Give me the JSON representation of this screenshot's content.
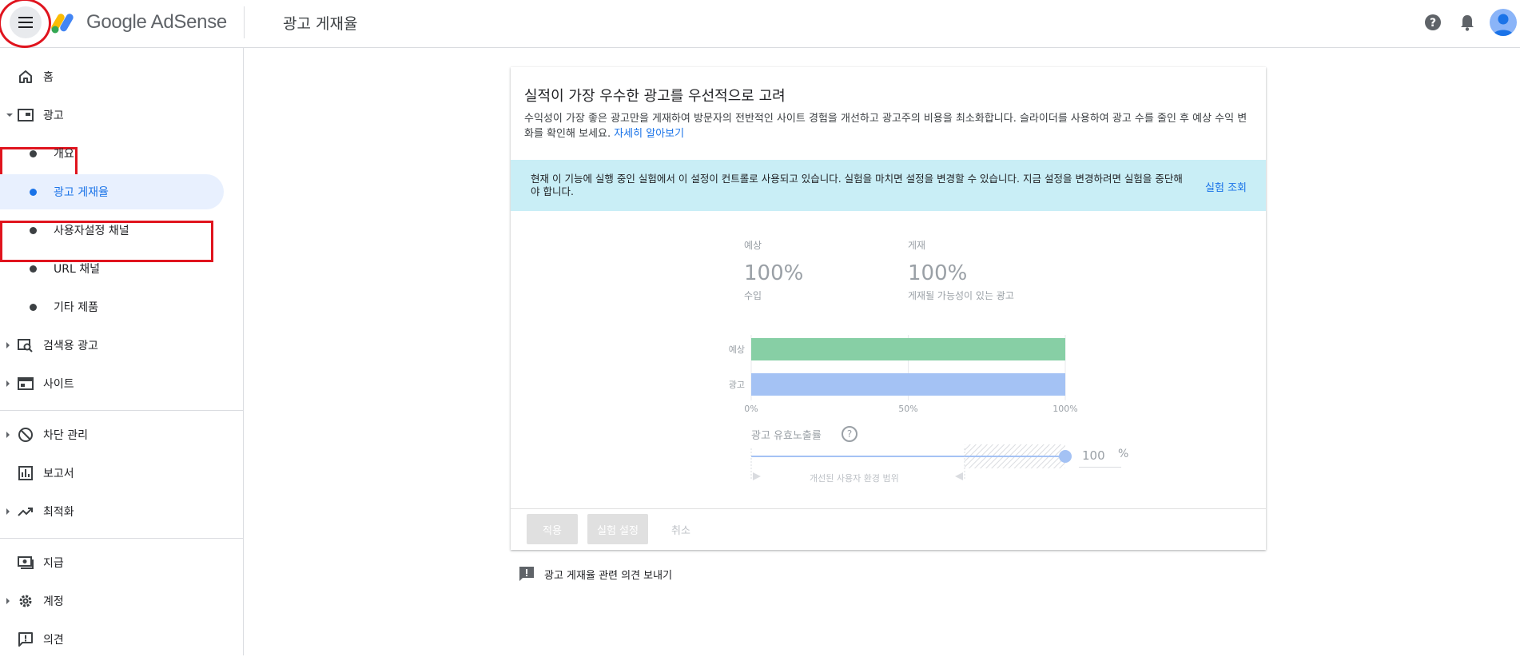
{
  "header": {
    "brand": "Google AdSense",
    "page_title": "광고 게재율",
    "icons": [
      "menu-icon",
      "help-icon",
      "notifications-icon",
      "account-icon"
    ]
  },
  "sidebar": {
    "items": [
      {
        "label": "홈",
        "icon": "home-icon"
      },
      {
        "label": "광고",
        "icon": "ads-icon"
      },
      {
        "label": "개요"
      },
      {
        "label": "광고 게재율"
      },
      {
        "label": "사용자설정 채널"
      },
      {
        "label": "URL 채널"
      },
      {
        "label": "기타 제품"
      },
      {
        "label": "검색용 광고",
        "icon": "search-ads-icon"
      },
      {
        "label": "사이트",
        "icon": "sites-icon"
      },
      {
        "label": "차단 관리",
        "icon": "block-icon"
      },
      {
        "label": "보고서",
        "icon": "reports-icon"
      },
      {
        "label": "최적화",
        "icon": "optimization-icon"
      },
      {
        "label": "지급",
        "icon": "payments-icon"
      },
      {
        "label": "계정",
        "icon": "settings-icon"
      },
      {
        "label": "의견",
        "icon": "feedback-icon"
      }
    ]
  },
  "card": {
    "title": "실적이 가장 우수한 광고를 우선적으로 고려",
    "description": "수익성이 가장 좋은 광고만을 게재하여 방문자의 전반적인 사이트 경험을 개선하고 광고주의 비용을 최소화합니다. 슬라이더를 사용하여 광고 수를 줄인 후 예상 수익 변화를 확인해 보세요.",
    "learn_more": "자세히 알아보기",
    "banner_text": "현재 이 기능에 실행 중인 실험에서 이 설정이 컨트롤로 사용되고 있습니다. 실험을 마치면 설정을 변경할 수 있습니다. 지금 설정을 변경하려면 실험을 중단해야 합니다.",
    "banner_link": "실험 조회",
    "stats": [
      {
        "label": "예상",
        "value": "100%",
        "sub": "수입"
      },
      {
        "label": "게재",
        "value": "100%",
        "sub": "게재될 가능성이 있는 광고"
      }
    ],
    "rate_label": "광고 유효노출률",
    "slider_value": "100",
    "slider_unit": "%",
    "slider_level": 1.0,
    "improved_range_label": "개선된 사용자 환경 범위",
    "buttons": {
      "apply": "적용",
      "experiment": "실험 설정",
      "cancel": "취소"
    }
  },
  "chart_data": {
    "type": "bar",
    "orientation": "horizontal",
    "categories": [
      "예상",
      "광고"
    ],
    "values": [
      100,
      100
    ],
    "colors": [
      "#87cfa5",
      "#a4c2f4"
    ],
    "xticks": [
      "0%",
      "50%",
      "100%"
    ],
    "xlim": [
      0,
      100
    ]
  },
  "feedback": {
    "label": "광고 게재율 관련 의견 보내기"
  }
}
